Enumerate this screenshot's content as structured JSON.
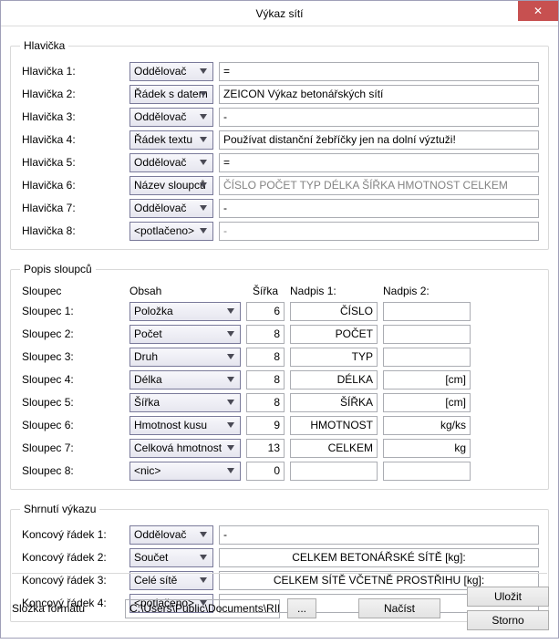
{
  "window": {
    "title": "Výkaz sítí"
  },
  "close_icon": "✕",
  "group_hlavicka": "Hlavička",
  "group_popis": "Popis sloupců",
  "group_shrnuti": "Shrnutí výkazu",
  "hlavicka_rows": [
    {
      "label": "Hlavička 1:",
      "combo": "Oddělovač",
      "value": "="
    },
    {
      "label": "Hlavička 2:",
      "combo": "Řádek s datem",
      "value": "ZEICON Výkaz betonářských sítí"
    },
    {
      "label": "Hlavička 3:",
      "combo": "Oddělovač",
      "value": "-"
    },
    {
      "label": "Hlavička 4:",
      "combo": "Řádek textu",
      "value": "Používat distanční žebříčky jen na dolní výztuži!"
    },
    {
      "label": "Hlavička 5:",
      "combo": "Oddělovač",
      "value": "="
    },
    {
      "label": "Hlavička 6:",
      "combo": "Název sloupců",
      "value": "ČÍSLO    POČET      TYP    DÉLKA    ŠÍŘKA  HMOTNOST      CELKEM",
      "readonly": true
    },
    {
      "label": "Hlavička 7:",
      "combo": "Oddělovač",
      "value": "-"
    },
    {
      "label": "Hlavička 8:",
      "combo": "<potlačeno>",
      "value": "-",
      "readonly": true
    }
  ],
  "popis_head": {
    "sloupec": "Sloupec",
    "obsah": "Obsah",
    "sirka": "Šířka",
    "nadpis1": "Nadpis 1:",
    "nadpis2": "Nadpis 2:"
  },
  "sloupce": [
    {
      "label": "Sloupec 1:",
      "obsah": "Položka",
      "sirka": "6",
      "n1": "ČÍSLO",
      "n2": ""
    },
    {
      "label": "Sloupec 2:",
      "obsah": "Počet",
      "sirka": "8",
      "n1": "POČET",
      "n2": ""
    },
    {
      "label": "Sloupec 3:",
      "obsah": "Druh",
      "sirka": "8",
      "n1": "TYP",
      "n2": ""
    },
    {
      "label": "Sloupec 4:",
      "obsah": "Délka",
      "sirka": "8",
      "n1": "DÉLKA",
      "n2": "[cm]"
    },
    {
      "label": "Sloupec 5:",
      "obsah": "Šířka",
      "sirka": "8",
      "n1": "ŠÍŘKA",
      "n2": "[cm]"
    },
    {
      "label": "Sloupec 6:",
      "obsah": "Hmotnost kusu",
      "sirka": "9",
      "n1": "HMOTNOST",
      "n2": "kg/ks"
    },
    {
      "label": "Sloupec 7:",
      "obsah": "Celková hmotnost",
      "sirka": "13",
      "n1": "CELKEM",
      "n2": "kg"
    },
    {
      "label": "Sloupec 8:",
      "obsah": "<nic>",
      "sirka": "0",
      "n1": "",
      "n2": ""
    }
  ],
  "shrnuti": [
    {
      "label": "Koncový řádek 1:",
      "combo": "Oddělovač",
      "value": "-",
      "center": false
    },
    {
      "label": "Koncový řádek 2:",
      "combo": "Součet",
      "value": "CELKEM BETONÁŘSKÉ SÍTĚ [kg]:",
      "center": true
    },
    {
      "label": "Koncový řádek 3:",
      "combo": "Celé sítě",
      "value": "CELKEM SÍTĚ VČETNĚ PROSTŘIHU [kg]:",
      "center": true
    },
    {
      "label": "Koncový řádek 4:",
      "combo": "<potlačeno>",
      "value": "",
      "center": false
    }
  ],
  "footer": {
    "label": "Složka formátu",
    "path": "C:\\Users\\Public\\Documents\\RII",
    "browse": "...",
    "load": "Načíst",
    "save": "Uložit",
    "cancel": "Storno"
  }
}
